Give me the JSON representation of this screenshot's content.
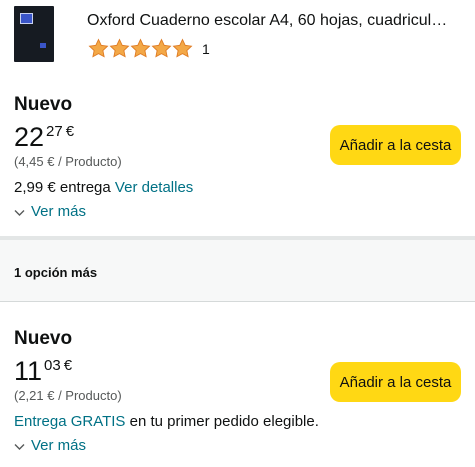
{
  "product": {
    "title": "Oxford Cuaderno escolar A4, 60 hojas, cuadricul…",
    "rating": 5,
    "rating_count": "1",
    "star_color": "#f3a847",
    "star_icon": "star-icon"
  },
  "offers": [
    {
      "condition": "Nuevo",
      "price_whole": "22",
      "price_fraction": "27",
      "currency": "€",
      "unit_price": "(4,45 € / Producto)",
      "delivery_prefix": "2,99 € entrega",
      "delivery_link": "Ver detalles",
      "delivery_suffix": "",
      "see_more": "Ver más",
      "add_to_cart": "Añadir a la cesta"
    },
    {
      "condition": "Nuevo",
      "price_whole": "11",
      "price_fraction": "03",
      "currency": "€",
      "unit_price": "(2,21 € / Producto)",
      "delivery_prefix": "",
      "delivery_link": "Entrega GRATIS",
      "delivery_suffix": "en tu primer pedido elegible.",
      "see_more": "Ver más",
      "add_to_cart": "Añadir a la cesta"
    }
  ],
  "more_options": {
    "label": "1 opción más"
  },
  "colors": {
    "button_bg": "#ffd814",
    "link": "#007185",
    "muted_text": "#565959"
  }
}
